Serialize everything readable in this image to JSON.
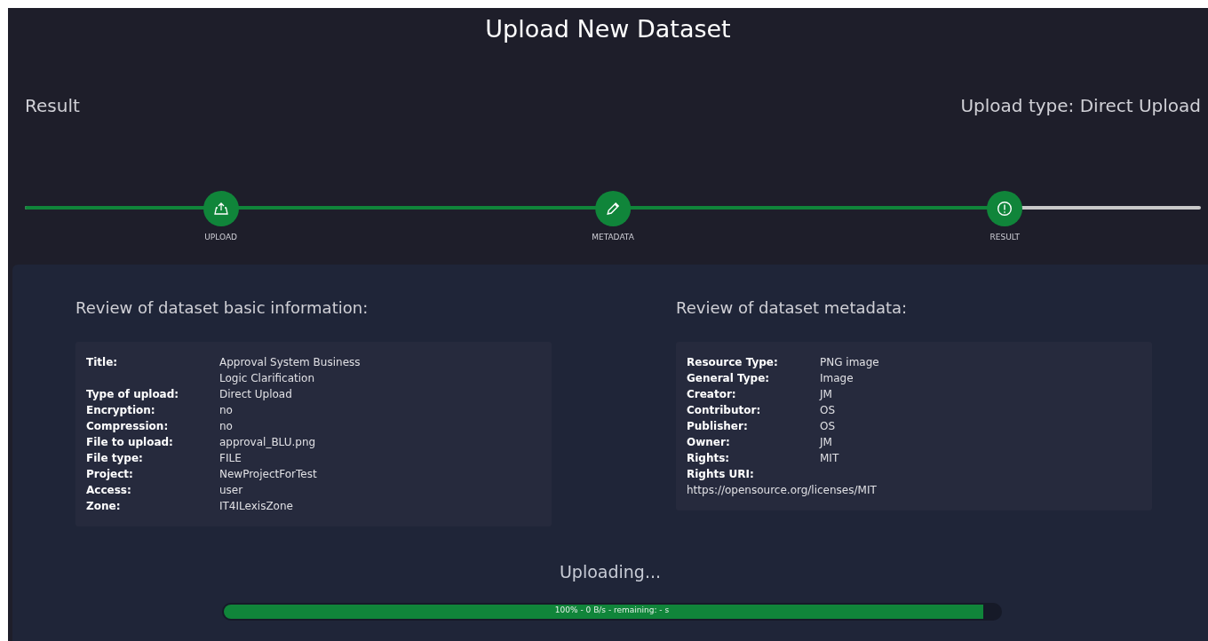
{
  "page_title": "Upload New Dataset",
  "section_title": "Result",
  "upload_type": "Upload type: Direct Upload",
  "stepper": {
    "level": 0.833,
    "steps": [
      {
        "label": "UPLOAD",
        "kind": "upload",
        "completed": true
      },
      {
        "label": "METADATA",
        "kind": "edit",
        "completed": true
      },
      {
        "label": "RESULT",
        "kind": "alert",
        "completed": true
      }
    ]
  },
  "basic_info": {
    "heading": "Review of dataset basic information:",
    "fields": [
      {
        "label": "Title:",
        "value": "Approval System Business Logic Clarification"
      },
      {
        "label": "Type of upload:",
        "value": "Direct Upload"
      },
      {
        "label": "Encryption:",
        "value": "no"
      },
      {
        "label": "Compression:",
        "value": "no"
      },
      {
        "label": "File to upload:",
        "value": "approval_BLU.png"
      },
      {
        "label": "File type:",
        "value": "FILE"
      },
      {
        "label": "Project:",
        "value": "NewProjectForTest"
      },
      {
        "label": "Access:",
        "value": "user"
      },
      {
        "label": "Zone:",
        "value": "IT4ILexisZone"
      }
    ]
  },
  "metadata": {
    "heading": "Review of dataset metadata:",
    "fields": [
      {
        "label": "Resource Type:",
        "value": "PNG image"
      },
      {
        "label": "General Type:",
        "value": "Image"
      },
      {
        "label": "Creator:",
        "value": "JM"
      },
      {
        "label": "Contributor:",
        "value": "OS"
      },
      {
        "label": "Publisher:",
        "value": "OS"
      },
      {
        "label": "Owner:",
        "value": "JM"
      },
      {
        "label": "Rights:",
        "value": "MIT"
      },
      {
        "label": "Rights URI:",
        "value": "https://opensource.org/licenses/MIT",
        "kind": "below"
      }
    ]
  },
  "upload": {
    "status": "Uploading...",
    "level": 0.978,
    "progress_text": "100% - 0 B/s - remaining: - s"
  }
}
